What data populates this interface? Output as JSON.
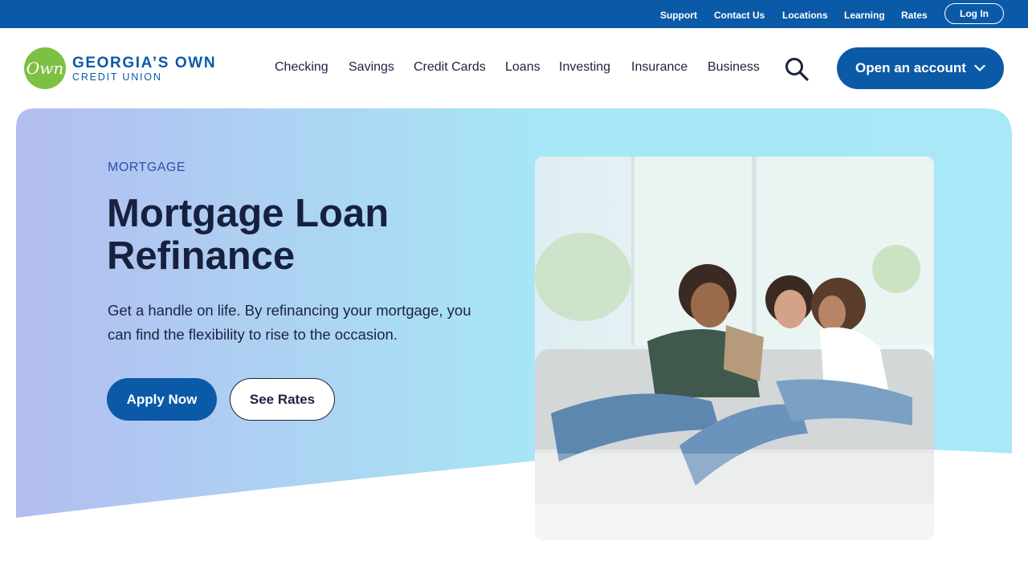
{
  "utility_nav": {
    "links": [
      "Support",
      "Contact Us",
      "Locations",
      "Learning",
      "Rates"
    ],
    "login_label": "Log In"
  },
  "brand": {
    "mark": "Own",
    "name_line1": "GEORGIA’S OWN",
    "name_line2": "CREDIT UNION",
    "primary_color": "#0b5aa8",
    "mark_color": "#7cc143"
  },
  "main_nav": {
    "items": [
      "Checking",
      "Savings",
      "Credit Cards",
      "Loans",
      "Investing",
      "Insurance",
      "Business"
    ],
    "search_icon": "magnifier-icon",
    "cta_label": "Open an account",
    "cta_icon": "chevron-down-icon"
  },
  "hero": {
    "eyebrow": "MORTGAGE",
    "title": "Mortgage Loan Refinance",
    "description": "Get a handle on life. By refinancing your mortgage, you can find the flexibility to rise to the occasion.",
    "primary_button": "Apply Now",
    "secondary_button": "See Rates",
    "gradient_colors": [
      "#b3bdf0",
      "#a6e8f6"
    ]
  }
}
